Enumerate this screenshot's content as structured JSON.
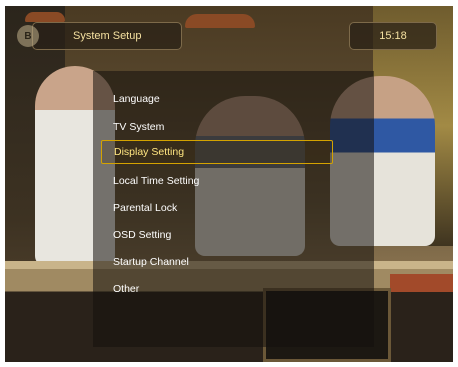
{
  "header": {
    "icon_text": "B",
    "title": "System Setup",
    "time": "15:18"
  },
  "menu": {
    "selected_index": 2,
    "items": [
      {
        "label": "Language"
      },
      {
        "label": "TV System"
      },
      {
        "label": "Display Setting"
      },
      {
        "label": "Local Time Setting"
      },
      {
        "label": "Parental Lock"
      },
      {
        "label": "OSD Setting"
      },
      {
        "label": "Startup Channel"
      },
      {
        "label": "Other"
      }
    ]
  },
  "colors": {
    "highlight_border": "#d4a300",
    "title_text": "#f4e0a0",
    "menu_text": "#ffffff"
  }
}
